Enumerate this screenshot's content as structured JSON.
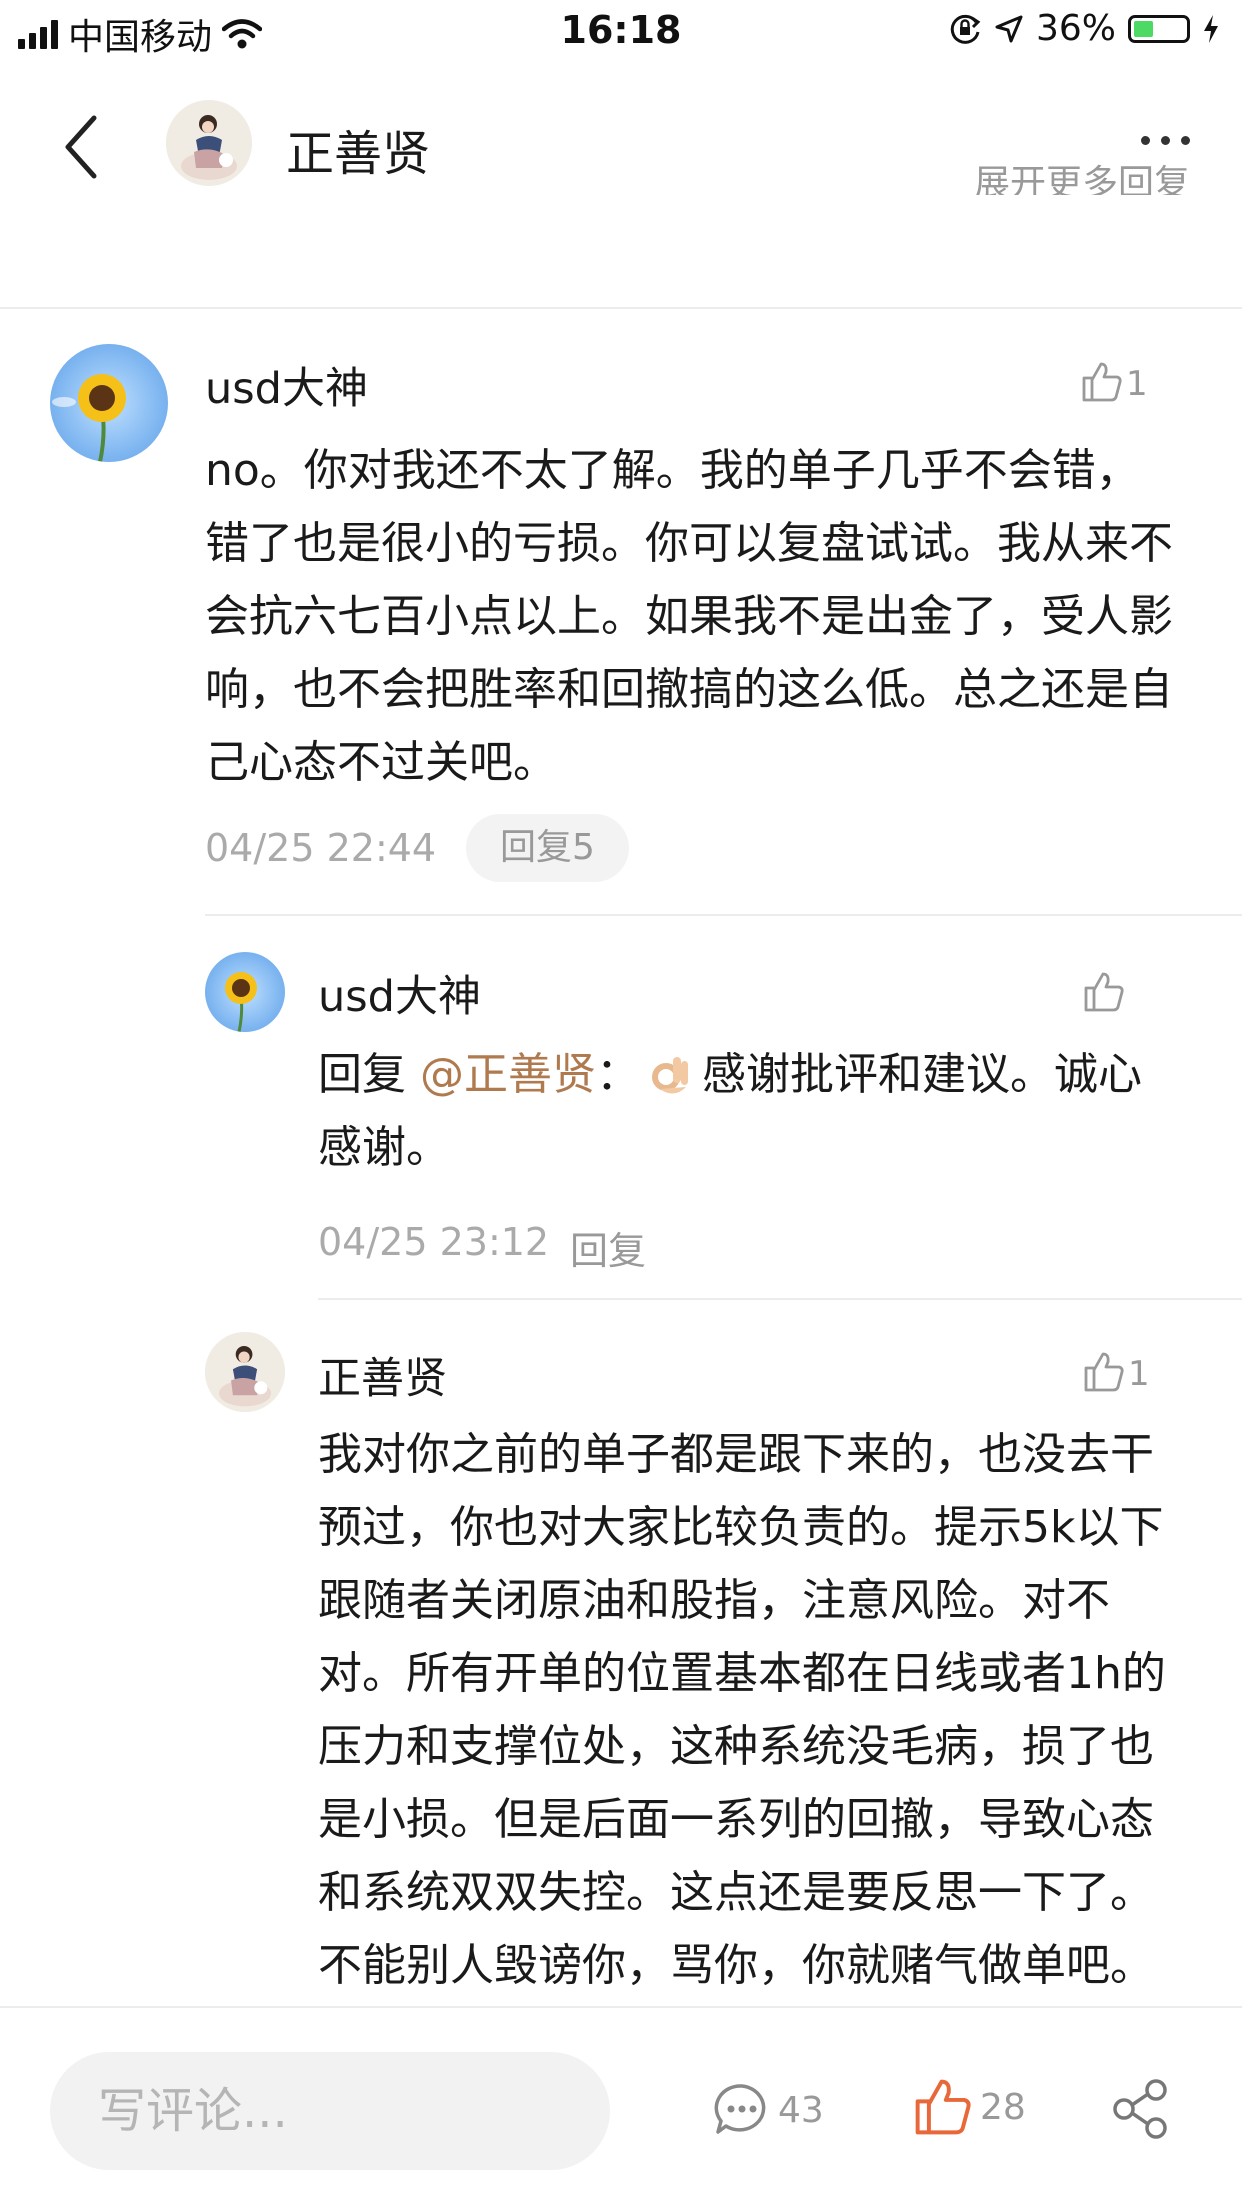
{
  "status_bar": {
    "carrier": "中国移动",
    "time": "16:18",
    "battery_percent": "36%",
    "battery_level": 0.36
  },
  "nav": {
    "title": "正善贤",
    "back_icon": "chevron-left-icon",
    "more_icon": "more-dots-icon"
  },
  "expand_more_label": "展开更多回复",
  "comments": [
    {
      "author": "usd大神",
      "likes": "1",
      "text": "no。你对我还不太了解。我的单子几乎不会错，错了也是很小的亏损。你可以复盘试试。我从来不会抗六七百小点以上。如果我不是出金了，受人影响，也不会把胜率和回撤搞的这么低。总之还是自己心态不过关吧。",
      "time": "04/25 22:44",
      "reply_label": "回复5"
    }
  ],
  "replies": [
    {
      "author": "usd大神",
      "reply_prefix": "回复",
      "mention": "@正善贤",
      "colon": "：",
      "text": "感谢批评和建议。诚心感谢。",
      "time": "04/25 23:12",
      "reply_label": "回复"
    },
    {
      "author": "正善贤",
      "likes": "1",
      "text": "我对你之前的单子都是跟下来的，也没去干预过，你也对大家比较负责的。提示5k以下跟随者关闭原油和股指，注意风险。对不对。所有开单的位置基本都在日线或者1h的压力和支撑位处，这种系统没毛病，损了也是小损。但是后面一系列的回撤，导致心态和系统双双失控。这点还是要反思一下了。不能别人毁谤你，骂你，你就赌气做单吧。"
    }
  ],
  "bottom_bar": {
    "input_placeholder": "写评论...",
    "comment_count": "43",
    "like_count": "28",
    "accent_color": "#e8683a"
  }
}
